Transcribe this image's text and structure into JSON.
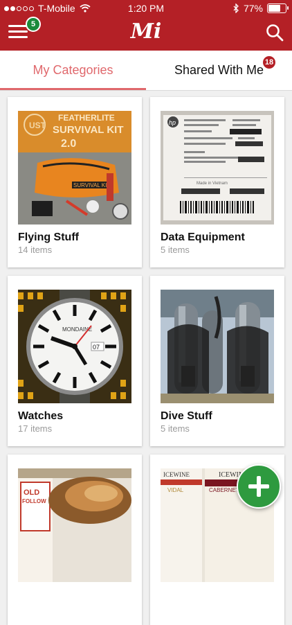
{
  "status_bar": {
    "carrier": "T-Mobile",
    "time": "1:20 PM",
    "battery": "77%",
    "battery_level": 0.77,
    "icons": [
      "signal-dots-icon",
      "wifi-icon",
      "bluetooth-icon",
      "battery-icon"
    ]
  },
  "header": {
    "logo": "Mi",
    "menu_badge": "5",
    "icons": [
      "hamburger-menu-icon",
      "search-icon"
    ],
    "colors": {
      "header": "#b42026",
      "accent": "#e0686c",
      "badge_green": "#1b8a3b",
      "fab_green": "#2e9a3f"
    }
  },
  "tabs": [
    {
      "label": "My Categories",
      "active": true
    },
    {
      "label": "Shared With Me",
      "badge": "18"
    }
  ],
  "categories": [
    {
      "name": "Flying Stuff",
      "count": "14 items",
      "image_text": [
        "FEATHERLITE",
        "SURVIVAL KIT",
        "2.0",
        "SURVIVAL KIT"
      ]
    },
    {
      "name": "Data Equipment",
      "count": "5 items",
      "image_text": [
        "hp",
        "Made in Vietnam"
      ]
    },
    {
      "name": "Watches",
      "count": "17 items",
      "image_text": [
        "MONDAINE",
        "07"
      ]
    },
    {
      "name": "Dive Stuff",
      "count": "5 items"
    },
    {
      "name": "",
      "count": "",
      "image_text": [
        "OLD",
        "FOLLOW"
      ]
    },
    {
      "name": "",
      "count": "",
      "image_text": [
        "ICEWINE",
        "ICEWINE",
        "VIDAL",
        "CABERNET FRANC"
      ]
    }
  ],
  "fab": {
    "icon": "plus-icon"
  }
}
